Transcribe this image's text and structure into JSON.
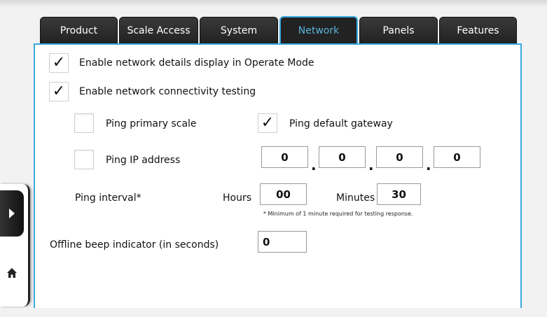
{
  "tabs": [
    {
      "label": "Product",
      "active": false
    },
    {
      "label": "Scale Access",
      "active": false
    },
    {
      "label": "System",
      "active": false
    },
    {
      "label": "Network",
      "active": true
    },
    {
      "label": "Panels",
      "active": false
    },
    {
      "label": "Features",
      "active": false
    }
  ],
  "accent_color": "#3aa9e0",
  "network": {
    "enable_details": {
      "label": "Enable network details display in Operate Mode",
      "checked": true
    },
    "enable_testing": {
      "label": "Enable network connectivity testing",
      "checked": true
    },
    "ping_primary": {
      "label": "Ping primary scale",
      "checked": false
    },
    "ping_gateway": {
      "label": "Ping default gateway",
      "checked": true
    },
    "ping_ip": {
      "label": "Ping IP address",
      "checked": false
    },
    "ip_octets": [
      "0",
      "0",
      "0",
      "0"
    ],
    "ip_separator": ".",
    "ping_interval": {
      "label": "Ping interval*",
      "hours_label": "Hours",
      "hours_value": "00",
      "minutes_label": "Minutes",
      "minutes_value": "30",
      "note": "* Minimum of 1 minute required for testing response."
    },
    "offline_beep": {
      "label": "Offline beep indicator (in seconds)",
      "value": "0"
    }
  },
  "check_glyph": "✓",
  "side_nav": {
    "icons": [
      "arrow-right-icon",
      "home-icon"
    ]
  }
}
